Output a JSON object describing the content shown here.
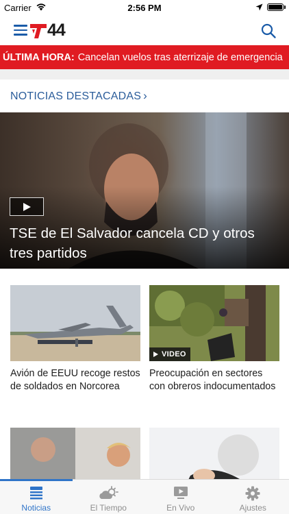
{
  "status_bar": {
    "carrier": "Carrier",
    "time": "2:56 PM"
  },
  "header": {
    "logo_text": "44",
    "menu_icon": "hamburger-menu-icon",
    "search_icon": "search-icon",
    "brand_color": "#e01b22",
    "accent_color": "#1a5ba8"
  },
  "breaking": {
    "tag": "ÚLTIMA HORA:",
    "text": "Cancelan vuelos tras aterrizaje de emergencia"
  },
  "featured": {
    "section_title": "NOTICIAS DESTACADAS",
    "chevron": "›",
    "hero": {
      "headline": "TSE de El Salvador cancela CD y otros tres partidos",
      "has_video": true
    }
  },
  "cards": [
    {
      "title": "Avión de EEUU recoge restos de soldados en Norcorea",
      "video": false
    },
    {
      "title": "Preocupación en sectores con obreros indocumentados",
      "video": true,
      "badge": "VIDEO"
    },
    {
      "title": "",
      "video": false
    },
    {
      "title": "",
      "video": false
    }
  ],
  "tabs": [
    {
      "label": "Noticias",
      "icon": "news-icon",
      "active": true
    },
    {
      "label": "El Tiempo",
      "icon": "weather-icon",
      "active": false
    },
    {
      "label": "En Vivo",
      "icon": "live-tv-icon",
      "active": false
    },
    {
      "label": "Ajustes",
      "icon": "settings-gear-icon",
      "active": false
    }
  ]
}
